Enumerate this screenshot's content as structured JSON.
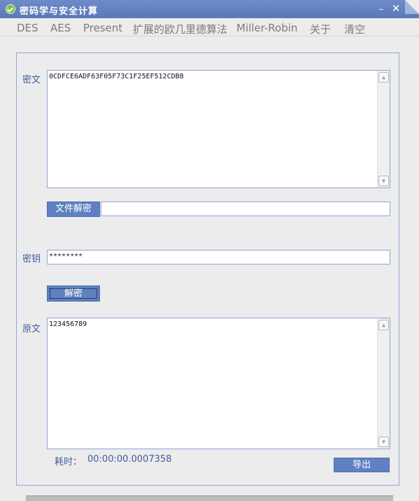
{
  "window": {
    "title": "密码学与安全计算",
    "min_symbol": "–",
    "close_symbol": "✕",
    "icon": "check-circle-icon"
  },
  "menu": [
    "DES",
    "AES",
    "Present",
    "扩展的欧几里德算法",
    "Miller-Robin",
    "关于",
    "清空"
  ],
  "ciphertext": {
    "label": "密文",
    "value": "0CDFCE6ADF63F05F73C1F25EF512CDB8"
  },
  "file_decrypt": {
    "button_label": "文件解密",
    "path_value": ""
  },
  "key": {
    "label": "密钥",
    "value": "********"
  },
  "decrypt": {
    "button_label": "解密"
  },
  "plaintext": {
    "label": "原文",
    "value": "123456789"
  },
  "timing": {
    "label": "耗时：",
    "value": "00:00:00.0007358"
  },
  "export": {
    "button_label": "导出"
  },
  "scroll_icons": {
    "up": "▲",
    "down": "▼"
  },
  "colors": {
    "titlebar": "#5f7fc0",
    "accent": "#5f80c2",
    "label_text": "#3e5e9e"
  }
}
